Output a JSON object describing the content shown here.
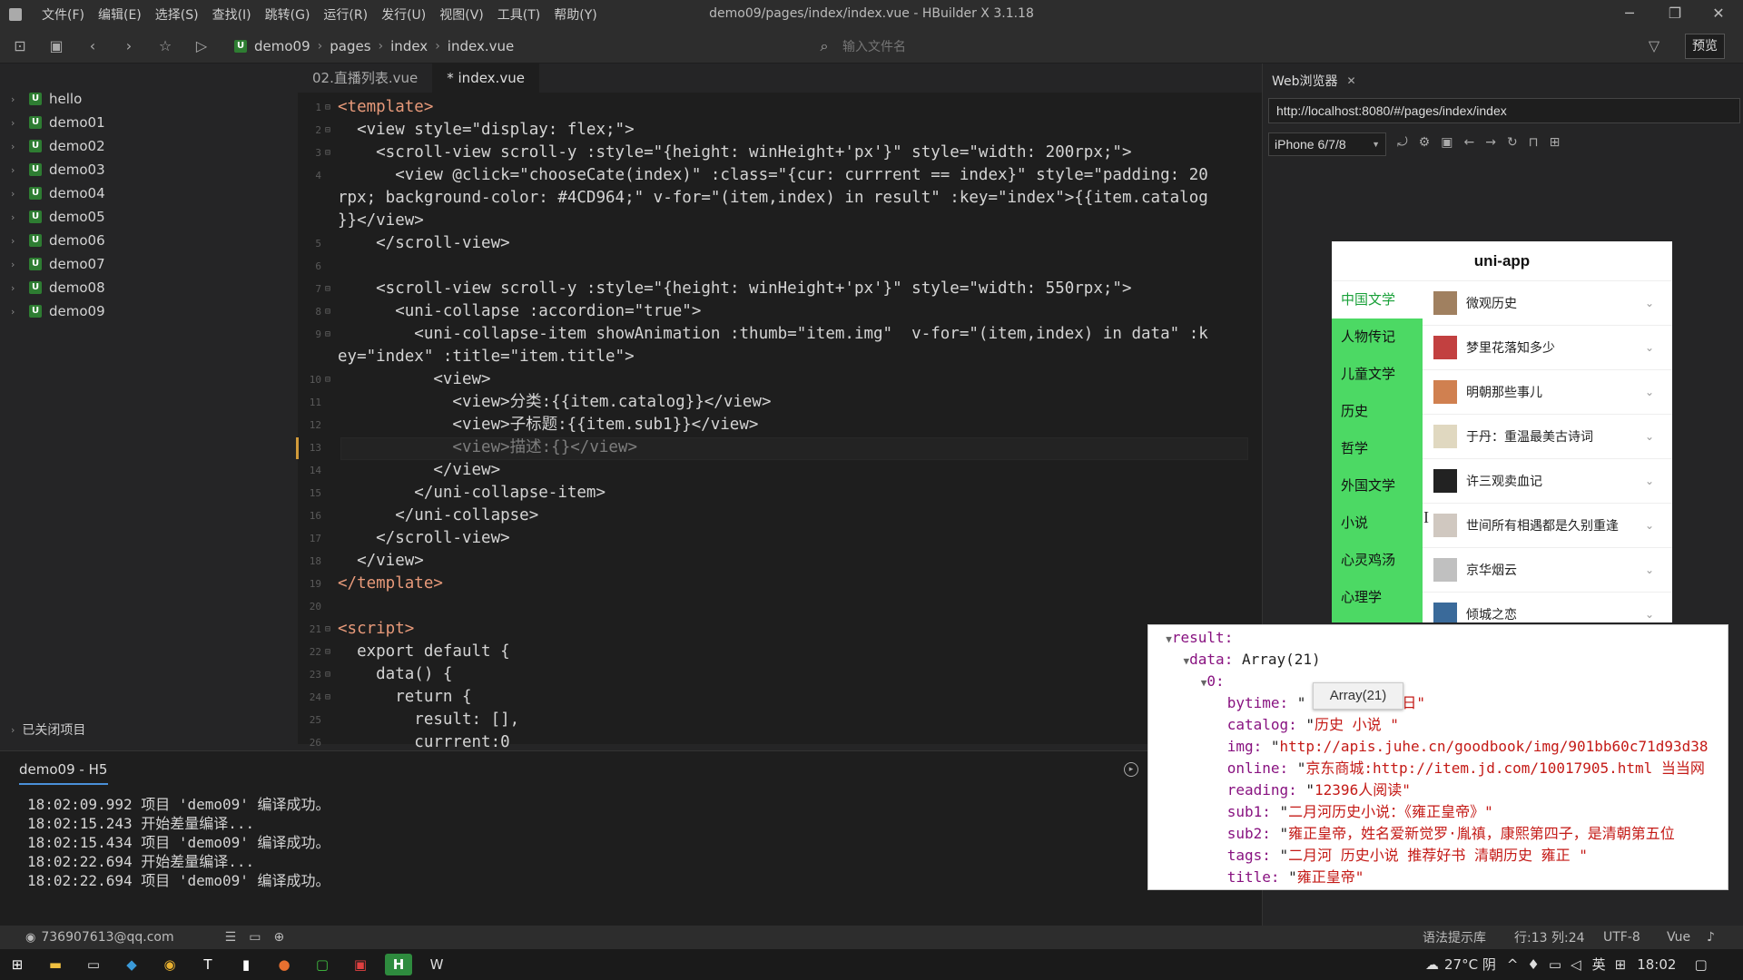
{
  "menubar": {
    "items": [
      "文件(F)",
      "编辑(E)",
      "选择(S)",
      "查找(I)",
      "跳转(G)",
      "运行(R)",
      "发行(U)",
      "视图(V)",
      "工具(T)",
      "帮助(Y)"
    ],
    "window_title": "demo09/pages/index/index.vue - HBuilder X 3.1.18"
  },
  "toolbar": {
    "breadcrumb": [
      "demo09",
      "pages",
      "index",
      "index.vue"
    ],
    "file_search_placeholder": "输入文件名",
    "preview_label": "预览"
  },
  "sidebar": {
    "projects": [
      "hello",
      "demo01",
      "demo02",
      "demo03",
      "demo04",
      "demo05",
      "demo06",
      "demo07",
      "demo08",
      "demo09"
    ],
    "closed_projects_label": "已关闭项目"
  },
  "editor": {
    "tabs": [
      "02.直播列表.vue",
      "* index.vue"
    ],
    "lines": [
      {
        "n": "1",
        "fold": "⊟",
        "text": "<template>"
      },
      {
        "n": "2",
        "fold": "⊟",
        "text": "  <view style=\"display: flex;\">"
      },
      {
        "n": "3",
        "fold": "⊟",
        "text": "    <scroll-view scroll-y :style=\"{height: winHeight+'px'}\" style=\"width: 200rpx;\">"
      },
      {
        "n": "4",
        "fold": "",
        "text": "      <view @click=\"chooseCate(index)\" :class=\"{cur: currrent == index}\" style=\"padding: 20"
      },
      {
        "n": "",
        "fold": "",
        "text": "rpx; background-color: #4CD964;\" v-for=\"(item,index) in result\" :key=\"index\">{{item.catalog"
      },
      {
        "n": "",
        "fold": "",
        "text": "}}</view>"
      },
      {
        "n": "5",
        "fold": "",
        "text": "    </scroll-view>"
      },
      {
        "n": "6",
        "fold": "",
        "text": ""
      },
      {
        "n": "7",
        "fold": "⊟",
        "text": "    <scroll-view scroll-y :style=\"{height: winHeight+'px'}\" style=\"width: 550rpx;\">"
      },
      {
        "n": "8",
        "fold": "⊟",
        "text": "      <uni-collapse :accordion=\"true\">"
      },
      {
        "n": "9",
        "fold": "⊟",
        "text": "        <uni-collapse-item showAnimation :thumb=\"item.img\"  v-for=\"(item,index) in data\" :k"
      },
      {
        "n": "",
        "fold": "",
        "text": "ey=\"index\" :title=\"item.title\">"
      },
      {
        "n": "10",
        "fold": "⊟",
        "text": "          <view>"
      },
      {
        "n": "11",
        "fold": "",
        "text": "            <view>分类:{{item.catalog}}</view>"
      },
      {
        "n": "12",
        "fold": "",
        "text": "            <view>子标题:{{item.sub1}}</view>"
      },
      {
        "n": "13",
        "fold": "",
        "text": "            <view>描述:{}</view>"
      },
      {
        "n": "14",
        "fold": "",
        "text": "          </view>"
      },
      {
        "n": "15",
        "fold": "",
        "text": "        </uni-collapse-item>"
      },
      {
        "n": "16",
        "fold": "",
        "text": "      </uni-collapse>"
      },
      {
        "n": "17",
        "fold": "",
        "text": "    </scroll-view>"
      },
      {
        "n": "18",
        "fold": "",
        "text": "  </view>"
      },
      {
        "n": "19",
        "fold": "",
        "text": "</template>"
      },
      {
        "n": "20",
        "fold": "",
        "text": ""
      },
      {
        "n": "21",
        "fold": "⊟",
        "text": "<script>"
      },
      {
        "n": "22",
        "fold": "⊟",
        "text": "  export default {"
      },
      {
        "n": "23",
        "fold": "⊟",
        "text": "    data() {"
      },
      {
        "n": "24",
        "fold": "⊟",
        "text": "      return {"
      },
      {
        "n": "25",
        "fold": "",
        "text": "        result: [],"
      },
      {
        "n": "26",
        "fold": "",
        "text": "        currrent:0"
      }
    ]
  },
  "console": {
    "title": "demo09 - H5",
    "logs": [
      "18:02:09.992 项目 'demo09' 编译成功。",
      "18:02:15.243 开始差量编译...",
      "18:02:15.434 项目 'demo09' 编译成功。",
      "18:02:22.694 开始差量编译...",
      "18:02:22.694 项目 'demo09' 编译成功。"
    ]
  },
  "browser": {
    "tab_label": "Web浏览器",
    "url": "http://localhost:8080/#/pages/index/index",
    "device": "iPhone 6/7/8",
    "phone_title": "uni-app",
    "categories": [
      "中国文学",
      "人物传记",
      "儿童文学",
      "历史",
      "哲学",
      "外国文学",
      "小说",
      "心灵鸡汤",
      "心理学"
    ],
    "books": [
      "微观历史",
      "梦里花落知多少",
      "明朝那些事儿",
      "于丹：重温最美古诗词",
      "许三观卖血记",
      "世间所有相遇都是久别重逢",
      "京华烟云",
      "倾城之恋"
    ],
    "thumb_colors": [
      "#a08060",
      "#c24040",
      "#d08050",
      "#e0d8c0",
      "#222222",
      "#d0c8c0",
      "#c0c0c0",
      "#3a6a9a"
    ]
  },
  "devtools": {
    "lines": [
      {
        "ind": "  ",
        "arrow": "▼",
        "key": "result:",
        "val": "",
        "str": ""
      },
      {
        "ind": "    ",
        "arrow": "▼",
        "key": "data:",
        "val": " Array(21)",
        "str": ""
      },
      {
        "ind": "      ",
        "arrow": "▼",
        "key": "0:",
        "val": "",
        "str": ""
      },
      {
        "ind": "         ",
        "arrow": "",
        "key": "bytime:",
        "val": " \"",
        "str": "          3日\""
      },
      {
        "ind": "         ",
        "arrow": "",
        "key": "catalog:",
        "val": " \"",
        "str": "历史 小说 \""
      },
      {
        "ind": "         ",
        "arrow": "",
        "key": "img:",
        "val": " \"",
        "str": "http://apis.juhe.cn/goodbook/img/901bb60c71d93d38"
      },
      {
        "ind": "         ",
        "arrow": "",
        "key": "online:",
        "val": " \"",
        "str": "京东商城:http://item.jd.com/10017905.html 当当网"
      },
      {
        "ind": "         ",
        "arrow": "",
        "key": "reading:",
        "val": " \"",
        "str": "12396人阅读\""
      },
      {
        "ind": "         ",
        "arrow": "",
        "key": "sub1:",
        "val": " \"",
        "str": "二月河历史小说：《雍正皇帝》\""
      },
      {
        "ind": "         ",
        "arrow": "",
        "key": "sub2:",
        "val": " \"",
        "str": "雍正皇帝，姓名爱新觉罗·胤禛，康熙第四子，是清朝第五位"
      },
      {
        "ind": "         ",
        "arrow": "",
        "key": "tags:",
        "val": " \"",
        "str": "二月河 历史小说 推荐好书 清朝历史 雍正 \""
      },
      {
        "ind": "         ",
        "arrow": "",
        "key": "title:",
        "val": " \"",
        "str": "雍正皇帝\""
      }
    ],
    "tooltip": "Array(21)"
  },
  "statusbar": {
    "user": "736907613@qq.com",
    "syntax_hint": "语法提示库",
    "position": "行:13  列:24",
    "encoding": "UTF-8",
    "language": "Vue"
  },
  "taskbar": {
    "weather": "27°C 阴",
    "ime": "英",
    "clock": "18:02"
  }
}
